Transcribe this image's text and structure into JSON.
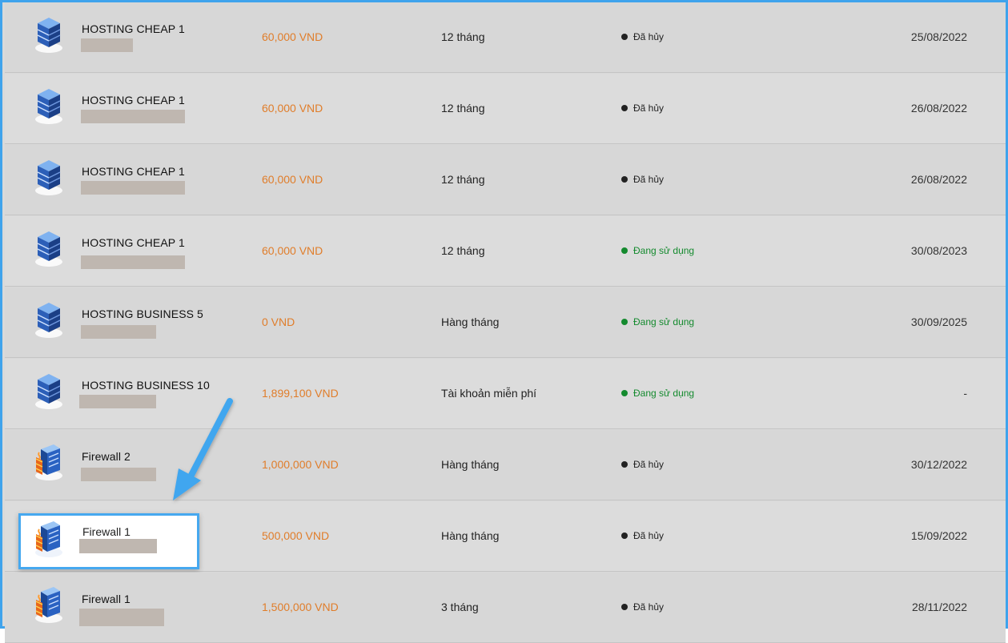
{
  "rows": [
    {
      "name": "HOSTING CHEAP 1",
      "price": "60,000 VND",
      "period": "12 tháng",
      "status": "Đã hủy",
      "active": false,
      "date": "25/08/2022",
      "icon": "server-icon"
    },
    {
      "name": "HOSTING CHEAP 1",
      "price": "60,000 VND",
      "period": "12 tháng",
      "status": "Đã hủy",
      "active": false,
      "date": "26/08/2022",
      "icon": "server-icon"
    },
    {
      "name": "HOSTING CHEAP 1",
      "price": "60,000 VND",
      "period": "12 tháng",
      "status": "Đã hủy",
      "active": false,
      "date": "26/08/2022",
      "icon": "server-icon"
    },
    {
      "name": "HOSTING CHEAP 1",
      "price": "60,000 VND",
      "period": "12 tháng",
      "status": "Đang sử dụng",
      "active": true,
      "date": "30/08/2023",
      "icon": "server-icon"
    },
    {
      "name": "HOSTING BUSINESS 5",
      "price": "0 VND",
      "period": "Hàng tháng",
      "status": "Đang sử dụng",
      "active": true,
      "date": "30/09/2025",
      "icon": "server-icon"
    },
    {
      "name": "HOSTING BUSINESS 10",
      "price": "1,899,100 VND",
      "period": "Tài khoản miễn phí",
      "status": "Đang sử dụng",
      "active": true,
      "date": "-",
      "icon": "server-icon"
    },
    {
      "name": "Firewall 2",
      "price": "1,000,000 VND",
      "period": "Hàng tháng",
      "status": "Đã hủy",
      "active": false,
      "date": "30/12/2022",
      "icon": "firewall-icon"
    },
    {
      "name": "Firewall 1",
      "price": "500,000 VND",
      "period": "Hàng tháng",
      "status": "Đã hủy",
      "active": false,
      "date": "15/09/2022",
      "icon": "firewall-icon"
    },
    {
      "name": "Firewall 1",
      "price": "1,500,000 VND",
      "period": "3 tháng",
      "status": "Đã hủy",
      "active": false,
      "date": "28/11/2022",
      "icon": "firewall-icon"
    }
  ],
  "colors": {
    "accent": "#3fa3ec",
    "price": "#e07d2a",
    "active": "#148a2e",
    "inactive": "#222222"
  },
  "highlighted_row": 7
}
